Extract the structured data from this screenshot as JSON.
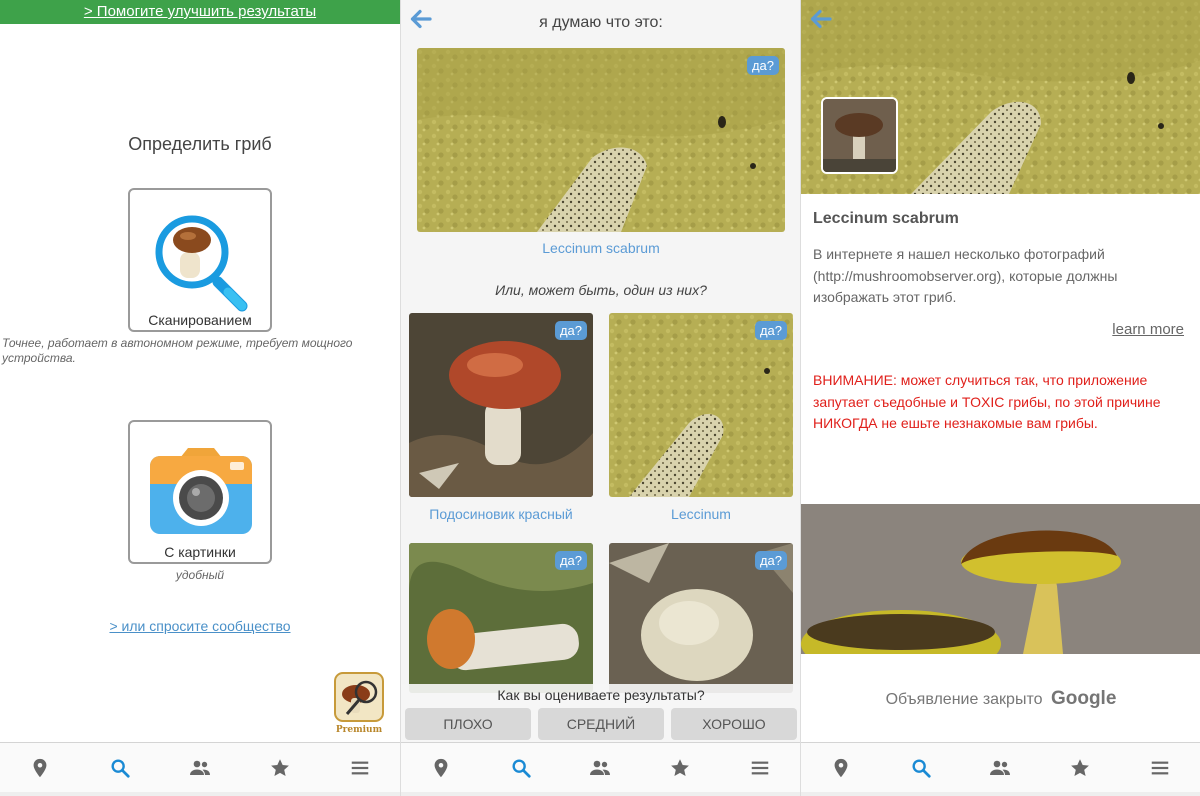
{
  "screen1": {
    "banner": "> Помогите улучшить результаты",
    "title": "Определить гриб",
    "scan_label": "Сканированием",
    "scan_note": "Точнее, работает в автономном режиме, требует мощного устройства.",
    "picture_label": "С картинки",
    "picture_note": "удобный",
    "community_link": "> или спросите сообщество",
    "premium_label": "Premium"
  },
  "screen2": {
    "header": "я думаю что это:",
    "main_badge": "да?",
    "main_caption": "Leccinum scabrum",
    "alt_title": "Или, может быть, один из них?",
    "cards": [
      {
        "badge": "да?",
        "caption": "Подосиновик красный"
      },
      {
        "badge": "да?",
        "caption": "Leccinum"
      },
      {
        "badge": "да?",
        "caption": ""
      },
      {
        "badge": "да?",
        "caption": ""
      }
    ],
    "rating_question": "Как вы оцениваете результаты?",
    "rating_buttons": [
      "ПЛОХО",
      "СРЕДНИЙ",
      "ХОРОШО"
    ]
  },
  "screen3": {
    "species": "Leccinum scabrum",
    "description": "В интернете я нашел несколько фотографий (http://mushroomobserver.org), которые должны изображать этот гриб.",
    "learn_more": "learn more",
    "warning": "ВНИМАНИЕ: может случиться так, что приложение запутает съедобные и TOXIC грибы, по этой причине НИКОГДА не ешьте незнакомые вам грибы.",
    "ad_closed": "Объявление закрыто",
    "ad_brand": "Google"
  },
  "nav_icons": [
    "map-pin-icon",
    "search-icon",
    "people-icon",
    "star-icon",
    "menu-icon"
  ],
  "colors": {
    "accent": "#1a8ad4",
    "banner_green": "#3ea24a",
    "link_blue": "#4a90c8",
    "badge_blue": "#5b9bd5",
    "warning_red": "#e0201b"
  }
}
